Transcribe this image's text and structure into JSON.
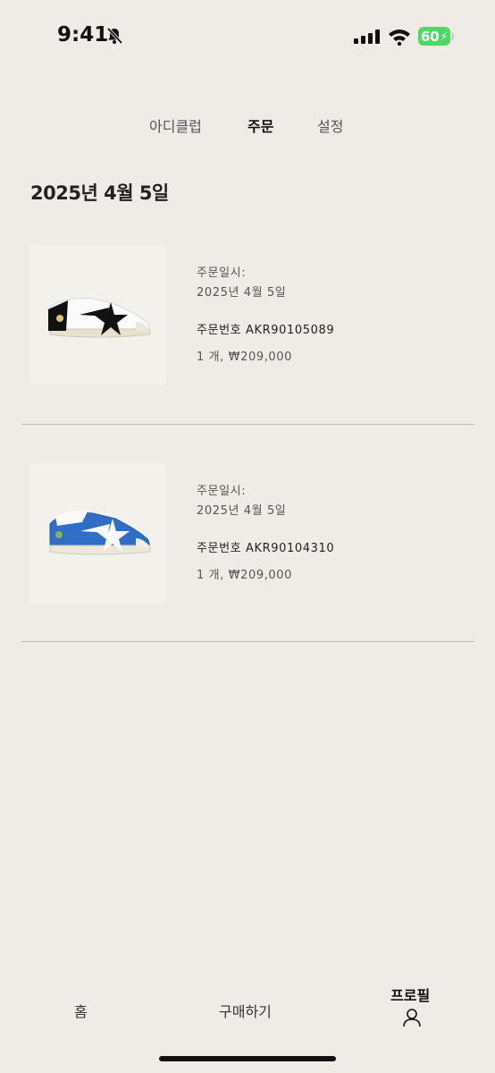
{
  "status_bar": {
    "time": "9:41",
    "battery": "60"
  },
  "tabs": [
    {
      "label": "아디클럽",
      "active": false
    },
    {
      "label": "주문",
      "active": true
    },
    {
      "label": "설정",
      "active": false
    }
  ],
  "date_heading": "2025년 4월 5일",
  "orders": [
    {
      "date_label": "주문일시:",
      "date": "2025년 4월 5일",
      "order_number": "주문번호 AKR90105089",
      "quantity_price": "1 개, ₩209,000",
      "shoe_color": "#1a1a1a"
    },
    {
      "date_label": "주문일시:",
      "date": "2025년 4월 5일",
      "order_number": "주문번호 AKR90104310",
      "quantity_price": "1 개, ₩209,000",
      "shoe_color": "#2f6ec7"
    }
  ],
  "bottom_nav": {
    "home": "홈",
    "shop": "구매하기",
    "profile": "프로필"
  }
}
